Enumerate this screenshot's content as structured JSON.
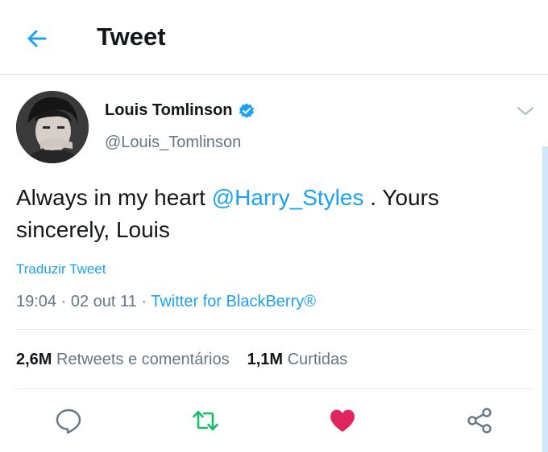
{
  "header": {
    "title": "Tweet",
    "back_icon": "arrow-left-icon"
  },
  "tweet": {
    "display_name": "Louis Tomlinson",
    "handle": "@Louis_Tomlinson",
    "verified": true,
    "text_before": "Always in my heart ",
    "mention": "@Harry_Styles",
    "text_after": " . Yours sincerely, Louis",
    "translate_label": "Traduzir Tweet",
    "time": "19:04",
    "date": "02 out 11",
    "source": "Twitter for BlackBerry®",
    "retweets_count": "2,6M",
    "retweets_label": "Retweets e comentários",
    "likes_count": "1,1M",
    "likes_label": "Curtidas"
  },
  "actions": [
    {
      "icon": "reply-icon"
    },
    {
      "icon": "retweet-icon"
    },
    {
      "icon": "like-icon"
    },
    {
      "icon": "share-icon"
    }
  ],
  "colors": {
    "accent": "#1da1f2",
    "retweet": "#17bf63",
    "like": "#e0245e",
    "muted": "#657786"
  }
}
